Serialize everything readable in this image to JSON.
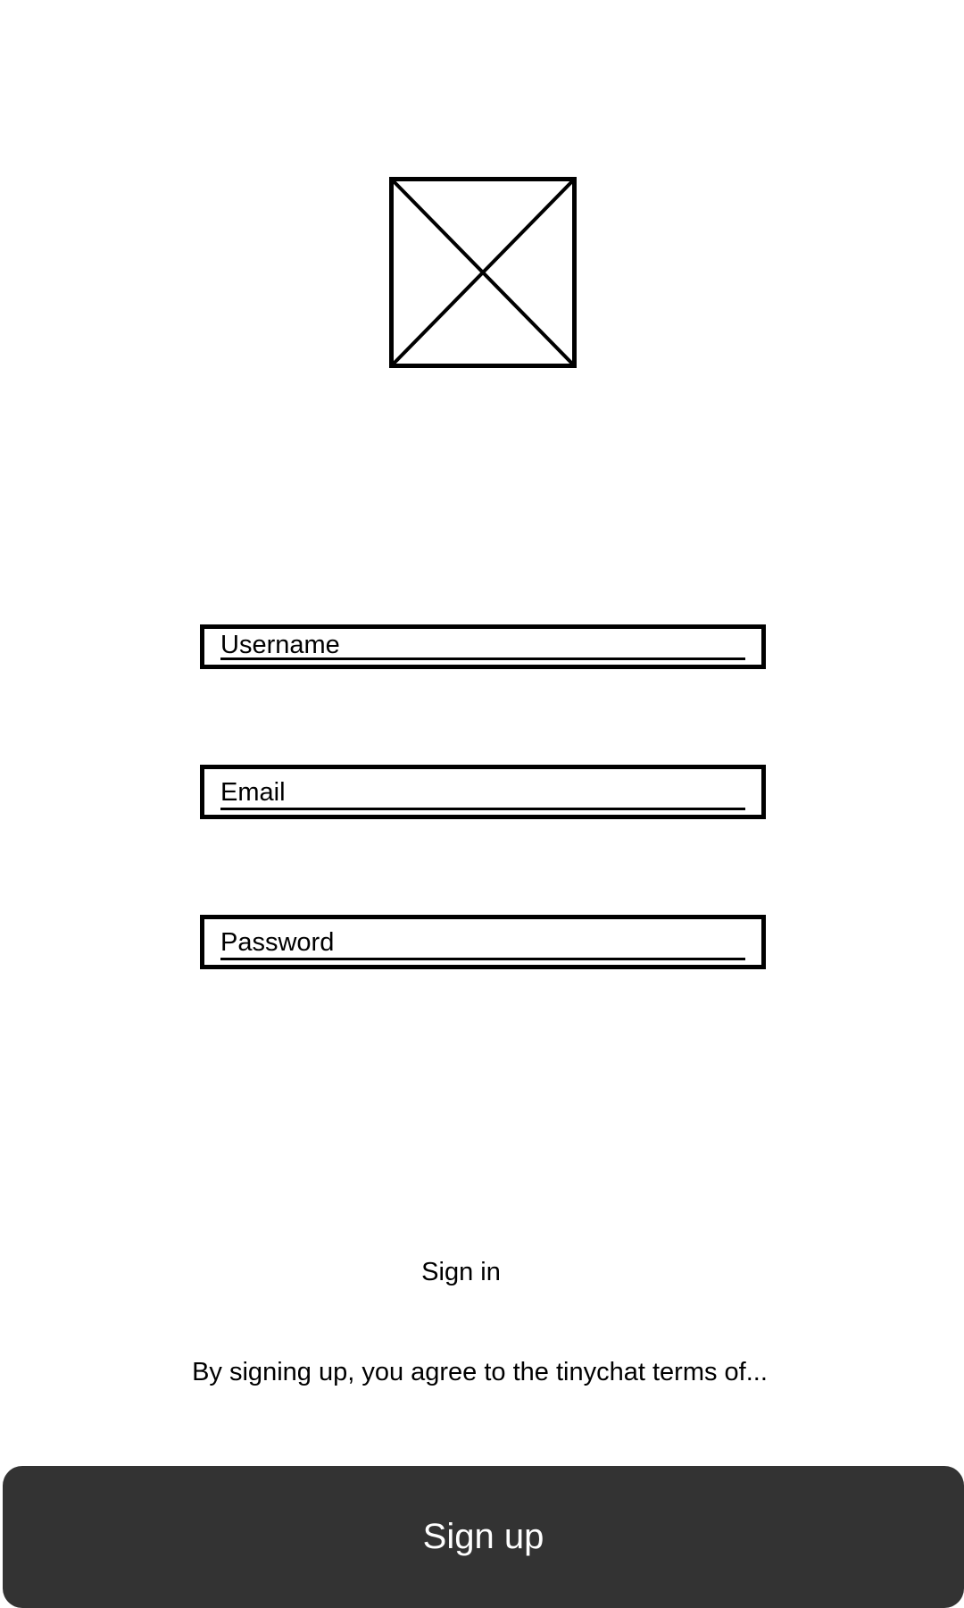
{
  "logo": {
    "icon": "image-placeholder-icon"
  },
  "form": {
    "username": {
      "placeholder": "Username"
    },
    "email": {
      "placeholder": "Email"
    },
    "password": {
      "placeholder": "Password"
    }
  },
  "links": {
    "sign_in": "Sign in"
  },
  "legal": {
    "terms": "By signing up, you agree to the tinychat terms of..."
  },
  "actions": {
    "sign_up": "Sign up"
  },
  "colors": {
    "background": "#ffffff",
    "outline": "#000000",
    "button_background": "#333333",
    "button_text": "#ffffff"
  }
}
